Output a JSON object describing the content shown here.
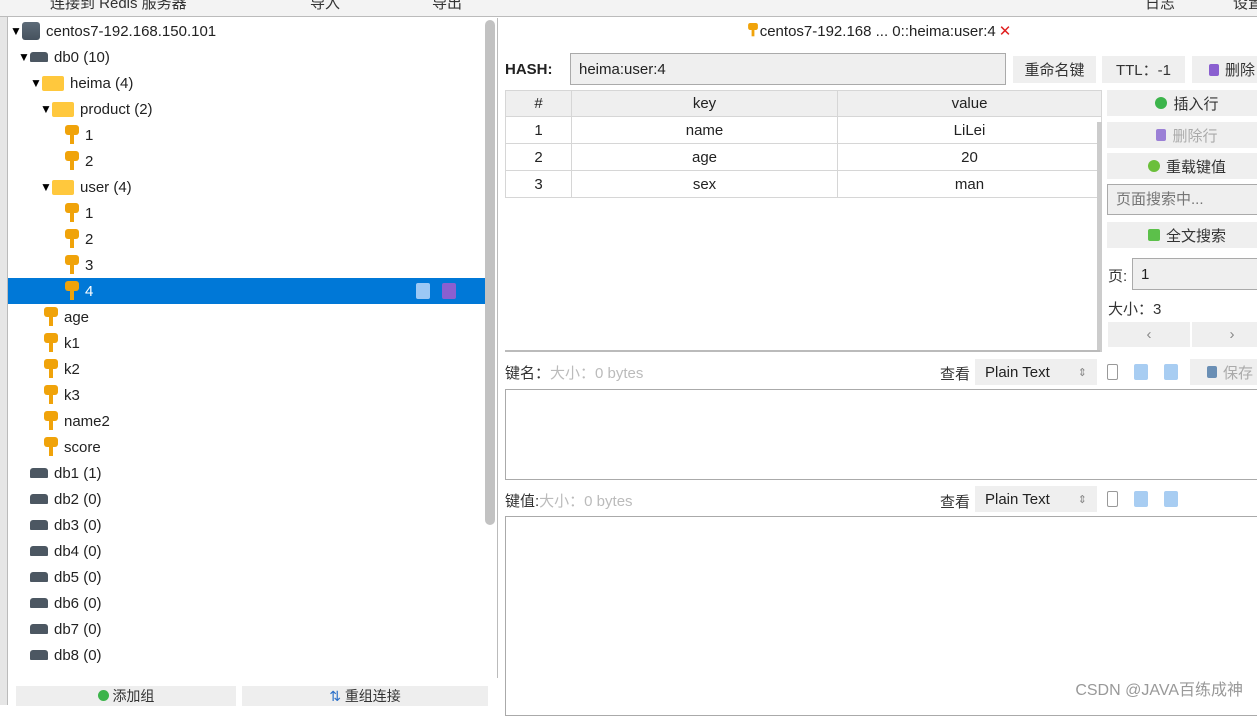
{
  "toolbar": {
    "connect": "连接到 Redis 服务器",
    "import": "导入",
    "export": "导出",
    "log": "日志",
    "settings": "设置"
  },
  "tree": [
    {
      "label": "centos7-192.168.150.101",
      "type": "server",
      "depth": 0,
      "expanded": true
    },
    {
      "label": "db0  (10)",
      "type": "db",
      "depth": 1,
      "expanded": true
    },
    {
      "label": "heima (4)",
      "type": "folder",
      "depth": 2,
      "expanded": true
    },
    {
      "label": "product (2)",
      "type": "folder",
      "depth": 3,
      "expanded": true
    },
    {
      "label": "1",
      "type": "key",
      "depth": 4
    },
    {
      "label": "2",
      "type": "key",
      "depth": 4
    },
    {
      "label": "user (4)",
      "type": "folder",
      "depth": 3,
      "expanded": true
    },
    {
      "label": "1",
      "type": "key",
      "depth": 4
    },
    {
      "label": "2",
      "type": "key",
      "depth": 4
    },
    {
      "label": "3",
      "type": "key",
      "depth": 4
    },
    {
      "label": "4",
      "type": "key",
      "depth": 4,
      "selected": true
    },
    {
      "label": "age",
      "type": "key",
      "depth": 2
    },
    {
      "label": "k1",
      "type": "key",
      "depth": 2
    },
    {
      "label": "k2",
      "type": "key",
      "depth": 2
    },
    {
      "label": "k3",
      "type": "key",
      "depth": 2
    },
    {
      "label": "name2",
      "type": "key",
      "depth": 2
    },
    {
      "label": "score",
      "type": "key",
      "depth": 2
    },
    {
      "label": "db1  (1)",
      "type": "db",
      "depth": 1
    },
    {
      "label": "db2  (0)",
      "type": "db",
      "depth": 1
    },
    {
      "label": "db3  (0)",
      "type": "db",
      "depth": 1
    },
    {
      "label": "db4  (0)",
      "type": "db",
      "depth": 1
    },
    {
      "label": "db5  (0)",
      "type": "db",
      "depth": 1
    },
    {
      "label": "db6  (0)",
      "type": "db",
      "depth": 1
    },
    {
      "label": "db7  (0)",
      "type": "db",
      "depth": 1
    },
    {
      "label": "db8  (0)",
      "type": "db",
      "depth": 1
    }
  ],
  "bottom": {
    "add_group": "添加组",
    "regroup": "重组连接"
  },
  "tab": {
    "title": "centos7-192.168 ... 0::heima:user:4",
    "close": "✕"
  },
  "key": {
    "type_label": "HASH:",
    "name": "heima:user:4",
    "rename": "重命名键",
    "ttl": "TTL：-1",
    "delete": "删除"
  },
  "table": {
    "headers": [
      "#",
      "key",
      "value"
    ],
    "rows": [
      [
        "1",
        "name",
        "LiLei"
      ],
      [
        "2",
        "age",
        "20"
      ],
      [
        "3",
        "sex",
        "man"
      ]
    ]
  },
  "side": {
    "insert": "插入行",
    "delete_row": "删除行",
    "reload": "重载键值",
    "search_placeholder": "页面搜索中...",
    "fulltext": "全文搜索",
    "page_label": "页:",
    "page": "1",
    "size": "大小：3",
    "prev": "‹",
    "next": "›"
  },
  "keyname": {
    "label": "键名：",
    "size": "大小：0 bytes",
    "view": "查看",
    "format": "Plain Text",
    "save": "保存"
  },
  "keyvalue": {
    "label": "键值:",
    "size": "大小：0 bytes",
    "view": "查看",
    "format": "Plain Text"
  },
  "watermark": "CSDN @JAVA百练成神",
  "colors": {
    "selection": "#0078d7",
    "key_icon": "#f0a30a",
    "folder": "#ffc83d",
    "close": "#e02020"
  }
}
